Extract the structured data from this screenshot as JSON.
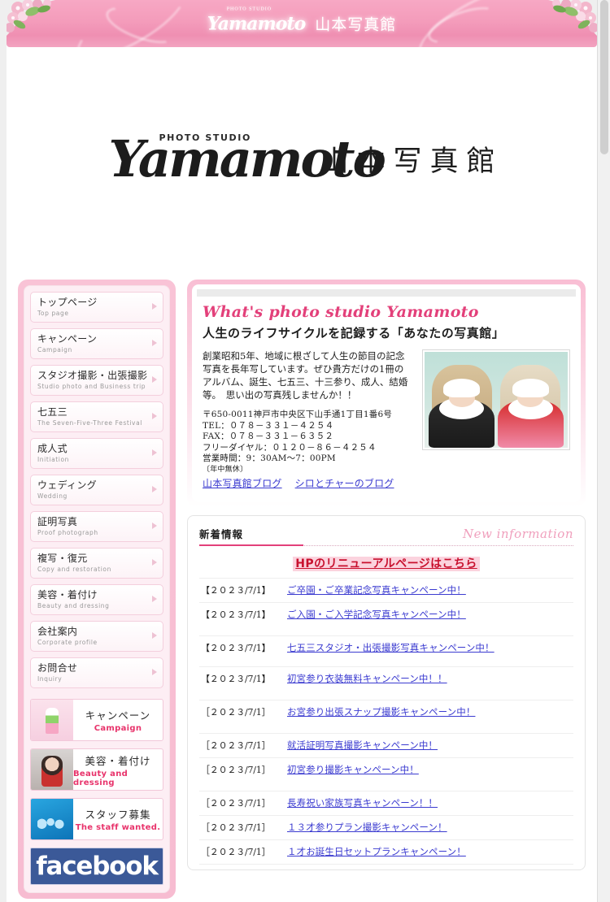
{
  "header": {
    "script_logo": "Yamamoto",
    "tiny_label": "PHOTO STUDIO",
    "jp_name": "山本写真館"
  },
  "logo": {
    "brush": "Yamamoto",
    "photo_studio": "PHOTO STUDIO",
    "jp_name": "山本写真館"
  },
  "sidebar": {
    "menu": [
      {
        "jp": "トップページ",
        "en": "Top page"
      },
      {
        "jp": "キャンペーン",
        "en": "Campaign"
      },
      {
        "jp": "スタジオ撮影・出張撮影",
        "en": "Studio photo and Business trip"
      },
      {
        "jp": "七五三",
        "en": "The Seven-Five-Three Festival"
      },
      {
        "jp": "成人式",
        "en": "Initiation"
      },
      {
        "jp": "ウェディング",
        "en": "Wedding"
      },
      {
        "jp": "証明写真",
        "en": "Proof photograph"
      },
      {
        "jp": "複写・復元",
        "en": "Copy and restoration"
      },
      {
        "jp": "美容・着付け",
        "en": "Beauty and dressing"
      },
      {
        "jp": "会社案内",
        "en": "Corporate profile"
      },
      {
        "jp": "お問合せ",
        "en": "Inquiry"
      }
    ],
    "banners": [
      {
        "jp": "キャンペーン",
        "en": "Campaign"
      },
      {
        "jp": "美容・着付け",
        "en": "Beauty and dressing"
      },
      {
        "jp": "スタッフ募集",
        "en": "The staff wanted."
      }
    ],
    "facebook_label": "facebook"
  },
  "intro": {
    "title": "What's photo studio Yamamoto",
    "subtitle": "人生のライフサイクルを記録する「あなたの写真館」",
    "paragraph": "創業昭和5年、地域に根ざして人生の節目の記念写真を長年写しています。ぜひ貴方だけの1冊のアルバム、誕生、七五三、十三参り、成人、結婚等。　思い出の写真残しませんか！！",
    "address": "〒650-0011神戸市中央区下山手通1丁目1番6号",
    "tel": "TEL：０７８－３３１－４２５４",
    "fax": "FAX：０７８－３３１－６３５２",
    "freedial": "フリーダイヤル：０１２０－８６－４２５４",
    "hours": "営業時間：9：30AM〜7：00PM",
    "holiday": "〔年中無休〕",
    "blog_link_1": "山本写真館ブログ",
    "blog_link_2": "シロとチャーのブログ"
  },
  "news": {
    "title_jp": "新着情報",
    "title_en": "New information",
    "highlight": "HPのリニューアルページはこちら",
    "items": [
      {
        "date": "【２０２３/7/1】",
        "link": "ご卒園・ご卒業記念写真キャンペーン中！"
      },
      {
        "date": "【２０２３/7/1】",
        "link": "ご入園・ご入学記念写真キャンペーン中！"
      },
      {
        "date": "【２０２３/7/1】",
        "link": "七五三スタジオ・出張撮影写真キャンペーン中！"
      },
      {
        "date": "【２０２３/7/1】",
        "link": "初宮参り衣装無料キャンペーン中！！"
      },
      {
        "date": "［２０２３/7/1］",
        "link": "お宮参り出張スナップ撮影キャンペーン中！"
      },
      {
        "date": "［２０２３/7/1］",
        "link": "就活証明写真撮影キャンペーン中！"
      },
      {
        "date": "［２０２３/7/1］",
        "link": "初宮参り撮影キャンペーン中！"
      },
      {
        "date": "［２０２３/7/1］",
        "link": "長寿祝い家族写真キャンペーン！！"
      },
      {
        "date": "［２０２３/7/1］",
        "link": "１３才参りプラン撮影キャンペーン！"
      },
      {
        "date": "［２０２３/7/1］",
        "link": "１才お誕生日セットプランキャンペーン！"
      }
    ]
  },
  "colors": {
    "pink": "#f49cbb",
    "accent_pink": "#e3407a",
    "link_blue": "#3b3bd0",
    "highlight_red": "#c8102e",
    "facebook_blue": "#3b5998"
  }
}
